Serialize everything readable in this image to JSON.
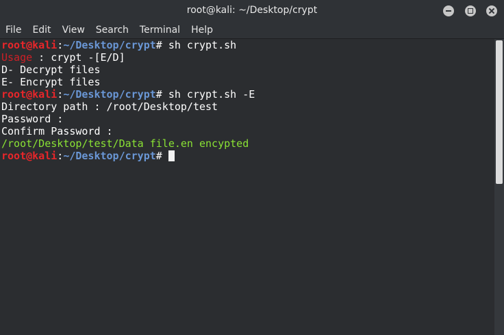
{
  "window": {
    "title": "root@kali: ~/Desktop/crypt"
  },
  "menu": [
    "File",
    "Edit",
    "View",
    "Search",
    "Terminal",
    "Help"
  ],
  "prompt": {
    "user": "root@kali",
    "colon": ":",
    "path": "~/Desktop/crypt",
    "symbol": "# "
  },
  "terminal": {
    "cmd1": "sh crypt.sh",
    "usage_label": "Usage",
    "usage_text": " : crypt -[E/D]",
    "line_d": "D- Decrypt files",
    "line_e": "E- Encrypt files",
    "cmd2": "sh crypt.sh -E",
    "dir_path": "Directory path : /root/Desktop/test",
    "password": "Password :",
    "confirm": "Confirm Password :",
    "result": "/root/Desktop/test/Data file.en encypted"
  },
  "colors": {
    "background": "#2b2d30",
    "prompt_user": "#e8262a",
    "prompt_path": "#6a97d6",
    "success": "#8ae234",
    "error": "#cf1f26"
  },
  "icons": [
    "minimize-icon",
    "maximize-icon",
    "close-icon"
  ]
}
